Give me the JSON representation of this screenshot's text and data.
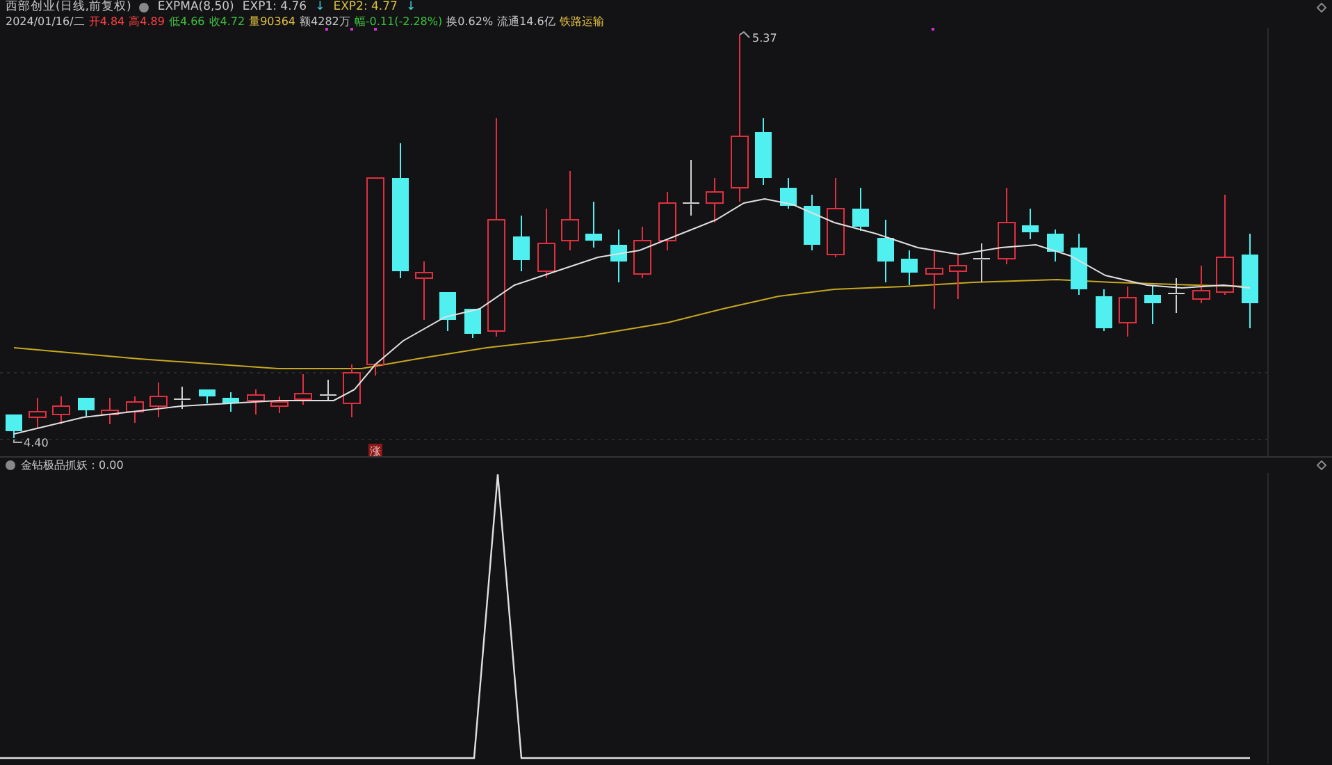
{
  "header": {
    "title": "西部创业(日线,前复权)",
    "indicator": "EXPMA(8,50)",
    "exp1": "EXP1: 4.76",
    "exp1_arrow": "↓",
    "exp2": "EXP2: 4.77",
    "exp2_arrow": "↓"
  },
  "quote": [
    {
      "text": "2024/01/16/二",
      "color": "#c8c8c8"
    },
    {
      "text": "开4.84",
      "color": "#ff4040"
    },
    {
      "text": "高4.89",
      "color": "#ff4040"
    },
    {
      "text": "低4.66",
      "color": "#3cc03c"
    },
    {
      "text": "收4.72",
      "color": "#3cc03c"
    },
    {
      "text": "量90364",
      "color": "#e0c040"
    },
    {
      "text": "额4282万",
      "color": "#c8c8c8"
    },
    {
      "text": "幅-0.11(-2.28%)",
      "color": "#3cc03c"
    },
    {
      "text": "换0.62%",
      "color": "#c8c8c8"
    },
    {
      "text": "流通14.6亿",
      "color": "#c8c8c8"
    },
    {
      "text": "铁路运输",
      "color": "#e0c040"
    }
  ],
  "chart": {
    "high_label": "5.37",
    "low_label": "4.40",
    "signal_badge": "涨"
  },
  "indicator_panel": {
    "title": "金钻极品抓妖：0.00"
  }
}
